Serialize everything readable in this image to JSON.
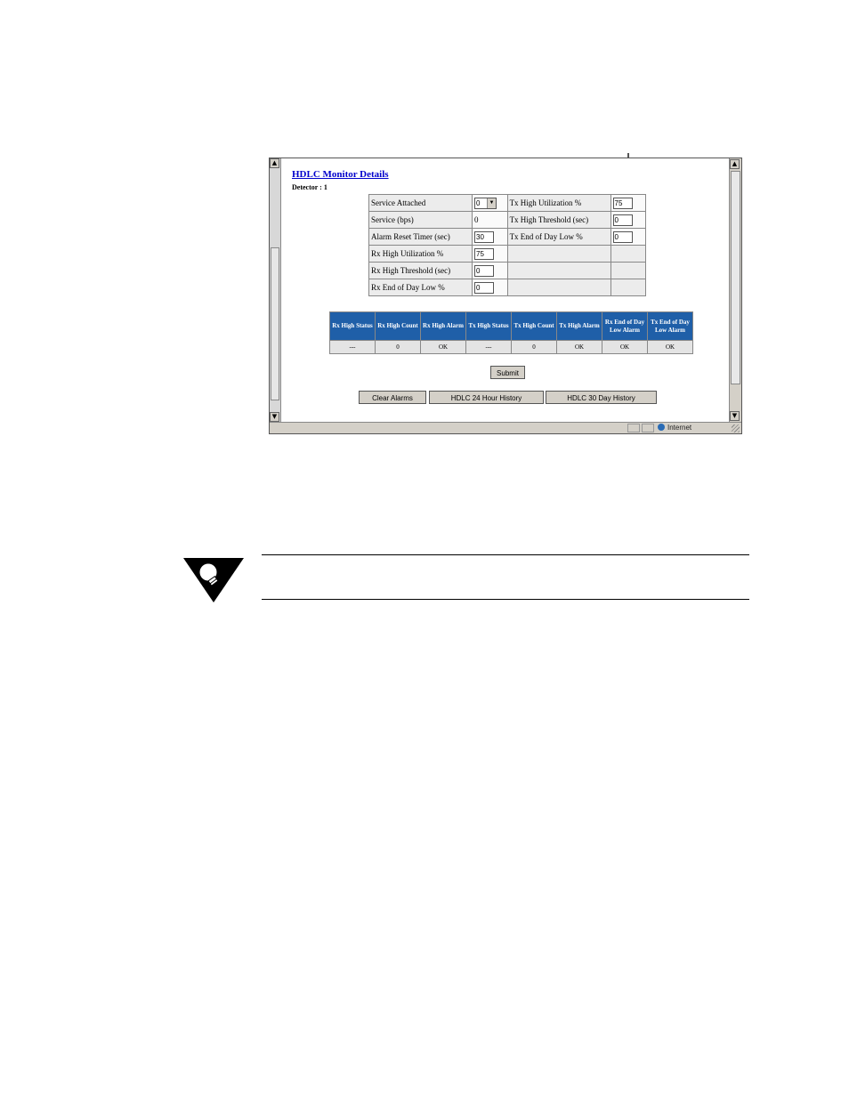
{
  "page": {
    "title": "HDLC Monitor Details",
    "detector_label": "Detector : 1"
  },
  "settings": {
    "rows": [
      {
        "label1": "Service Attached",
        "value1": "0",
        "label2": "Tx High Utilization %",
        "value2": "75"
      },
      {
        "label1": "Service (bps)",
        "value1": "0",
        "label2": "Tx High Threshold (sec)",
        "value2": "0"
      },
      {
        "label1": "Alarm Reset Timer (sec)",
        "value1": "30",
        "label2": "Tx End of Day Low %",
        "value2": "0"
      },
      {
        "label1": "Rx High Utilization %",
        "value1": "75",
        "label2": "",
        "value2": ""
      },
      {
        "label1": "Rx High Threshold (sec)",
        "value1": "0",
        "label2": "",
        "value2": ""
      },
      {
        "label1": "Rx End of Day Low %",
        "value1": "0",
        "label2": "",
        "value2": ""
      }
    ]
  },
  "alarm_table": {
    "headers": [
      "Rx High Status",
      "Rx High Count",
      "Rx High Alarm",
      "Tx High Status",
      "Tx High Count",
      "Tx High Alarm",
      "Rx End of Day Low Alarm",
      "Tx End of Day Low Alarm"
    ],
    "values": [
      "---",
      "0",
      "OK",
      "---",
      "0",
      "OK",
      "OK",
      "OK"
    ],
    "header_color": "#1f5fa8"
  },
  "buttons": {
    "submit": "Submit",
    "clear_alarms": "Clear Alarms",
    "history_24h": "HDLC 24 Hour History",
    "history_30d": "HDLC 30 Day History"
  },
  "statusbar": {
    "zone": "Internet",
    "zone_icon": "globe-icon"
  },
  "note": {
    "icon": "lightbulb-note-icon"
  }
}
